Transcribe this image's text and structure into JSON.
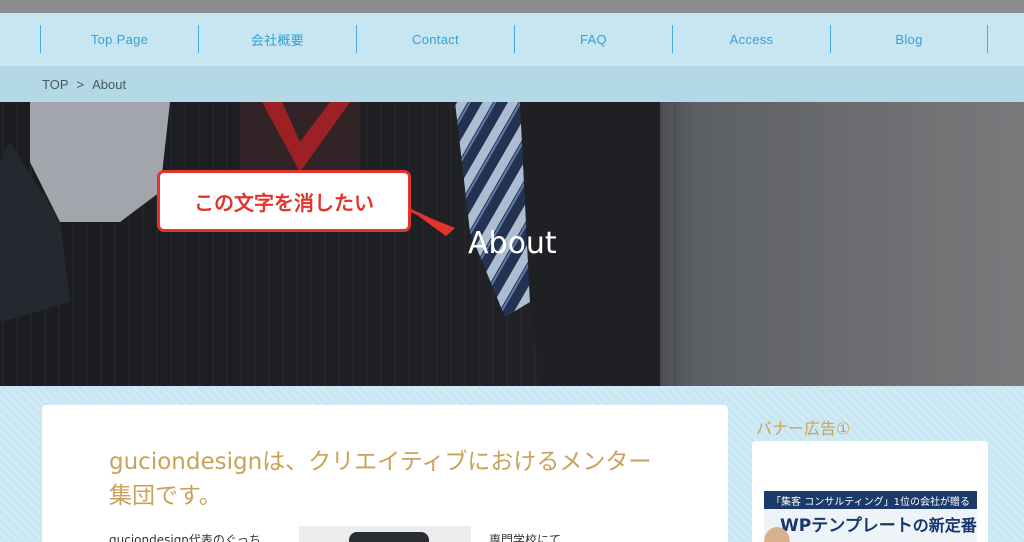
{
  "nav": {
    "items": [
      {
        "label": "Top Page"
      },
      {
        "label": "会社概要"
      },
      {
        "label": "Contact"
      },
      {
        "label": "FAQ"
      },
      {
        "label": "Access"
      },
      {
        "label": "Blog"
      }
    ]
  },
  "breadcrumb": {
    "home": "TOP",
    "separator": ">",
    "current": "About"
  },
  "hero": {
    "title": "About",
    "callout": "この文字を消したい",
    "callout_color": "#e3342b"
  },
  "main": {
    "heading": "guciondesignは、クリエイティブにおけるメンター集団です。",
    "text_left": "guciondesign代表のぐっち",
    "text_right": "専門学校にて"
  },
  "sidebar": {
    "widget_title": "バナー広告①",
    "banner_line1": "「集客 コンサルティング」1位の会社が贈る",
    "banner_line2_main": "WPテンプレート",
    "banner_line2_tail": "の新定番"
  },
  "colors": {
    "nav_text": "#3a9fd2",
    "heading_gold": "#c9a25a",
    "page_bg": "#c9e7f3"
  }
}
